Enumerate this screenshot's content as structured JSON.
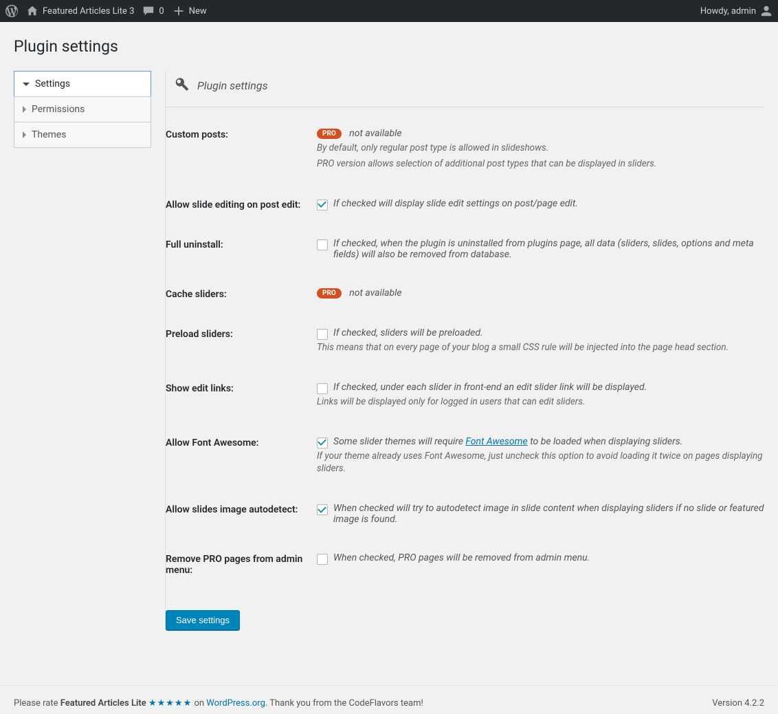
{
  "adminbar": {
    "siteName": "Featured Articles Lite 3",
    "commentCount": "0",
    "newLabel": "New",
    "greeting": "Howdy, admin"
  },
  "pageTitle": "Plugin settings",
  "sideTabs": {
    "settings": "Settings",
    "permissions": "Permissions",
    "themes": "Themes"
  },
  "section": {
    "title": "Plugin settings"
  },
  "fields": {
    "customPosts": {
      "label": "Custom posts:",
      "pro": "PRO",
      "na": "not available",
      "help1": "By default, only regular post type is allowed in slideshows.",
      "help2": "PRO version allows selection of additional post types that can be displayed in sliders."
    },
    "slideEditing": {
      "label": "Allow slide editing on post edit:",
      "cbLabel": "If checked will display slide edit settings on post/page edit."
    },
    "fullUninstall": {
      "label": "Full uninstall:",
      "cbLabel": "If checked, when the plugin is uninstalled from plugins page, all data (sliders, slides, options and meta fields) will also be removed from database."
    },
    "cacheSliders": {
      "label": "Cache sliders:",
      "pro": "PRO",
      "na": "not available"
    },
    "preloadSliders": {
      "label": "Preload sliders:",
      "cbLabel": "If checked, sliders will be preloaded.",
      "help": "This means that on every page of your blog a small CSS rule will be injected into the page head section."
    },
    "showEditLinks": {
      "label": "Show edit links:",
      "cbLabel": "If checked, under each slider in front-end an edit slider link will be displayed.",
      "help": "Links will be displayed only for logged in users that can edit sliders."
    },
    "fontAwesome": {
      "label": "Allow Font Awesome:",
      "cbPre": "Some slider themes will require ",
      "linkText": "Font Awesome",
      "cbPost": " to be loaded when displaying sliders.",
      "help": "If your theme already uses Font Awesome, just uncheck this option to avoid loading it twice on pages displaying sliders."
    },
    "autodetect": {
      "label": "Allow slides image autodetect:",
      "cbLabel": "When checked will try to autodetect image in slide content when displaying sliders if no slide or featured image is found."
    },
    "removePro": {
      "label": "Remove PRO pages from admin menu:",
      "cbLabel": "When checked, PRO pages will be removed from admin menu."
    }
  },
  "saveBtn": "Save settings",
  "footer": {
    "pre": "Please rate ",
    "bold": "Featured Articles Lite ",
    "stars": "★★★★★",
    "on": " on ",
    "wporg": "WordPress.org",
    "thanks": ". Thank you from the CodeFlavors team!",
    "version": "Version 4.2.2"
  }
}
